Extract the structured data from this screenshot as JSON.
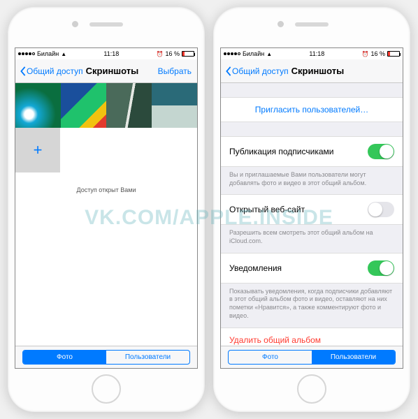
{
  "status": {
    "carrier": "Билайн",
    "time": "11:18",
    "battery_pct": "16 %"
  },
  "left": {
    "back_label": "Общий доступ",
    "title": "Скриншоты",
    "select_label": "Выбрать",
    "add_symbol": "+",
    "shared_by_you": "Доступ открыт Вами",
    "tab_photos": "Фото",
    "tab_users": "Пользователи"
  },
  "right": {
    "back_label": "Общий доступ",
    "title": "Скриншоты",
    "invite_label": "Пригласить пользователей…",
    "pub_title": "Публикация подписчиками",
    "pub_desc": "Вы и приглашаемые Вами пользователи могут добавлять фото и видео в этот общий альбом.",
    "site_title": "Открытый веб-сайт",
    "site_desc": "Разрешить всем смотреть этот общий альбом на iCloud.com.",
    "notif_title": "Уведомления",
    "notif_desc": "Показывать уведомления, когда подписчики добавляют в этот общий альбом фото и видео, оставляют на них пометки «Нравится», а также комментируют фото и видео.",
    "delete_label": "Удалить общий альбом",
    "tab_photos": "Фото",
    "tab_users": "Пользователи"
  },
  "watermark": "VK.COM/APPLE.INSIDE"
}
